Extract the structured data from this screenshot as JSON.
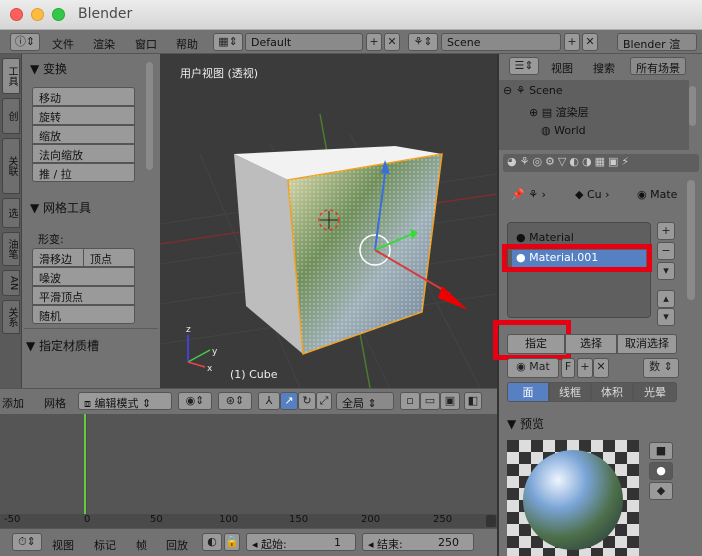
{
  "window": {
    "title": "Blender"
  },
  "topbar": {
    "menus": [
      "文件",
      "渲染",
      "窗口",
      "帮助"
    ],
    "layout": "Default",
    "scene": "Scene",
    "engine": "Blender 渲染"
  },
  "tool_tabs": [
    "工具",
    "创",
    "关联",
    "选",
    "油笔",
    "AN",
    "关系"
  ],
  "transform": {
    "heading": "变换",
    "buttons": [
      "移动",
      "旋转",
      "缩放",
      "法向缩放",
      "推 / 拉"
    ]
  },
  "mesh_tools": {
    "heading": "网格工具",
    "deform_label": "形变:",
    "slide_edge": "滑移边",
    "vertex": "顶点",
    "buttons": [
      "噪波",
      "平滑顶点",
      "随机"
    ]
  },
  "assign_material_panel": "指定材质槽",
  "viewport": {
    "label": "用户视图 (透视)",
    "object": "(1) Cube",
    "axis_x": "x",
    "axis_y": "y",
    "axis_z": "z"
  },
  "view3d_header": {
    "menus": [
      "添加",
      "网格"
    ],
    "mode": "编辑模式",
    "orientation": "全局"
  },
  "timeline": {
    "ticks": [
      "-50",
      "0",
      "50",
      "100",
      "150",
      "200",
      "250"
    ],
    "current_frame": 1,
    "menus": [
      "视图",
      "标记",
      "帧",
      "回放"
    ],
    "start_label": "起始:",
    "start": "1",
    "end_label": "结束:",
    "end": "250"
  },
  "outliner": {
    "view": "视图",
    "search": "搜索",
    "filter": "所有场景",
    "items": [
      "Scene",
      "渲染层",
      "World"
    ]
  },
  "properties": {
    "breadcrumb_object": "Cu",
    "breadcrumb_material": "Mate",
    "slots": [
      "Material",
      "Material.001"
    ],
    "selected_slot": "Material.001",
    "assign": "指定",
    "select": "选择",
    "deselect": "取消选择",
    "material_name": "Mat",
    "fake_user": "F",
    "data_label": "数",
    "preview_tabs": [
      "面",
      "线框",
      "体积",
      "光晕"
    ],
    "preview_heading": "预览"
  },
  "colors": {
    "highlight": "#e60012",
    "selected_slot": "#5680c2"
  }
}
